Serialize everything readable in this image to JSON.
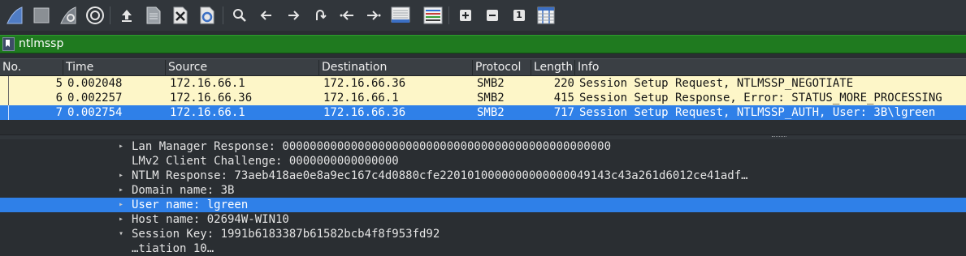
{
  "toolbar": {
    "icons": [
      "shark-fin-start-icon",
      "stop-square-icon",
      "shark-fin-restart-icon",
      "capture-options-gear-icon",
      "open-file-icon",
      "file-icon",
      "close-file-icon",
      "reload-file-icon",
      "search-icon",
      "back-arrow-icon",
      "forward-arrow-icon",
      "go-to-packet-icon",
      "first-packet-icon",
      "last-packet-icon",
      "autoscroll-icon",
      "colorize-icon",
      "zoom-in-icon",
      "zoom-out-icon",
      "normal-size-icon",
      "resize-columns-icon"
    ],
    "normal_size_label": "1"
  },
  "filter": {
    "value": "ntlmssp"
  },
  "columns": [
    "No.",
    "Time",
    "Source",
    "Destination",
    "Protocol",
    "Length",
    "Info"
  ],
  "packets": [
    {
      "no": "5",
      "time": "0.002048",
      "source": "172.16.66.1",
      "destination": "172.16.66.36",
      "protocol": "SMB2",
      "length": "220",
      "info": "Session Setup Request, NTLMSSP_NEGOTIATE",
      "selected": false
    },
    {
      "no": "6",
      "time": "0.002257",
      "source": "172.16.66.36",
      "destination": "172.16.66.1",
      "protocol": "SMB2",
      "length": "415",
      "info": "Session Setup Response, Error: STATUS_MORE_PROCESSING",
      "selected": false
    },
    {
      "no": "7",
      "time": "0.002754",
      "source": "172.16.66.1",
      "destination": "172.16.66.36",
      "protocol": "SMB2",
      "length": "717",
      "info": "Session Setup Request, NTLMSSP_AUTH, User: 3B\\lgreen",
      "selected": true
    }
  ],
  "details": [
    {
      "arrow": "▸",
      "text": "Lan Manager Response: 000000000000000000000000000000000000000000000000",
      "selected": false
    },
    {
      "arrow": "",
      "text": "LMv2 Client Challenge: 0000000000000000",
      "selected": false
    },
    {
      "arrow": "▸",
      "text": "NTLM Response: 73aeb418ae0e8a9ec167c4d0880cfe2201010000000000000049143c43a261d6012ce41adf…",
      "selected": false
    },
    {
      "arrow": "▸",
      "text": "Domain name: 3B",
      "selected": false
    },
    {
      "arrow": "▸",
      "text": "User name: lgreen",
      "selected": true
    },
    {
      "arrow": "▸",
      "text": "Host name: 02694W-WIN10",
      "selected": false
    },
    {
      "arrow": "▾",
      "text": "Session Key: 1991b6183387b61582bcb4f8f953fd92",
      "selected": false
    },
    {
      "arrow": "",
      "text": "…tiation 10…",
      "selected": false
    }
  ],
  "colors": {
    "filter_valid": "#1f7a1f",
    "row_highlight": "#fdf6c8",
    "selection": "#2f80e8"
  }
}
